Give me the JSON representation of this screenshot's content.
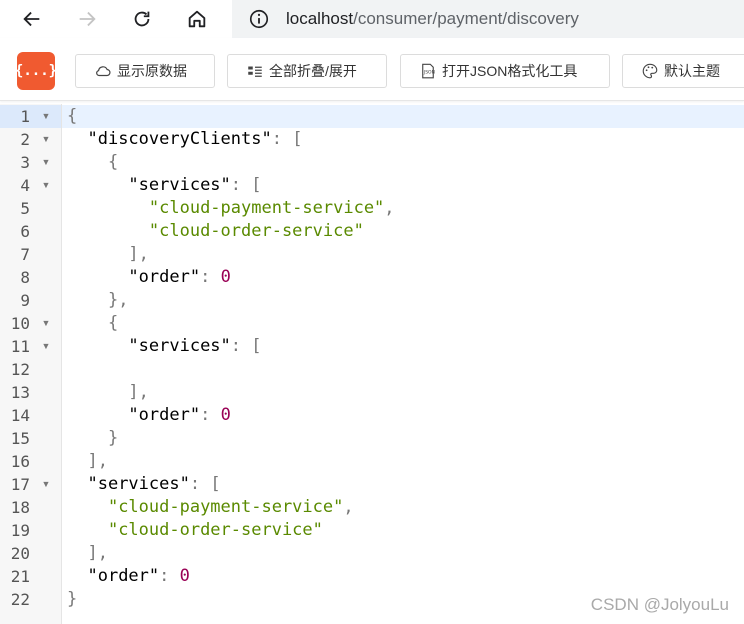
{
  "browser": {
    "url_host": "localhost",
    "url_path": "/consumer/payment/discovery",
    "icons": [
      "back-icon",
      "forward-icon",
      "reload-icon",
      "home-icon",
      "info-icon"
    ]
  },
  "toolbar": {
    "logo_text": "{...}",
    "raw_label": "显示原数据",
    "fold_label": "全部折叠/展开",
    "json_tool_label": "打开JSON格式化工具",
    "theme_label": "默认主题",
    "accent_color": "#f05a30"
  },
  "json_view": {
    "lines": [
      {
        "n": "1",
        "fold": true,
        "indent": 0,
        "tokens": [
          {
            "t": "p",
            "v": "{"
          }
        ]
      },
      {
        "n": "2",
        "fold": true,
        "indent": 1,
        "tokens": [
          {
            "t": "k",
            "v": "\"discoveryClients\""
          },
          {
            "t": "p",
            "v": ": ["
          }
        ]
      },
      {
        "n": "3",
        "fold": true,
        "indent": 2,
        "tokens": [
          {
            "t": "p",
            "v": "{"
          }
        ]
      },
      {
        "n": "4",
        "fold": true,
        "indent": 3,
        "tokens": [
          {
            "t": "k",
            "v": "\"services\""
          },
          {
            "t": "p",
            "v": ": ["
          }
        ]
      },
      {
        "n": "5",
        "fold": false,
        "indent": 4,
        "tokens": [
          {
            "t": "s",
            "v": "\"cloud-payment-service\""
          },
          {
            "t": "p",
            "v": ","
          }
        ]
      },
      {
        "n": "6",
        "fold": false,
        "indent": 4,
        "tokens": [
          {
            "t": "s",
            "v": "\"cloud-order-service\""
          }
        ]
      },
      {
        "n": "7",
        "fold": false,
        "indent": 3,
        "tokens": [
          {
            "t": "p",
            "v": "],"
          }
        ]
      },
      {
        "n": "8",
        "fold": false,
        "indent": 3,
        "tokens": [
          {
            "t": "k",
            "v": "\"order\""
          },
          {
            "t": "p",
            "v": ": "
          },
          {
            "t": "n",
            "v": "0"
          }
        ]
      },
      {
        "n": "9",
        "fold": false,
        "indent": 2,
        "tokens": [
          {
            "t": "p",
            "v": "},"
          }
        ]
      },
      {
        "n": "10",
        "fold": true,
        "indent": 2,
        "tokens": [
          {
            "t": "p",
            "v": "{"
          }
        ]
      },
      {
        "n": "11",
        "fold": true,
        "indent": 3,
        "tokens": [
          {
            "t": "k",
            "v": "\"services\""
          },
          {
            "t": "p",
            "v": ": ["
          }
        ]
      },
      {
        "n": "12",
        "fold": false,
        "indent": 3,
        "tokens": []
      },
      {
        "n": "13",
        "fold": false,
        "indent": 3,
        "tokens": [
          {
            "t": "p",
            "v": "],"
          }
        ]
      },
      {
        "n": "14",
        "fold": false,
        "indent": 3,
        "tokens": [
          {
            "t": "k",
            "v": "\"order\""
          },
          {
            "t": "p",
            "v": ": "
          },
          {
            "t": "n",
            "v": "0"
          }
        ]
      },
      {
        "n": "15",
        "fold": false,
        "indent": 2,
        "tokens": [
          {
            "t": "p",
            "v": "}"
          }
        ]
      },
      {
        "n": "16",
        "fold": false,
        "indent": 1,
        "tokens": [
          {
            "t": "p",
            "v": "],"
          }
        ]
      },
      {
        "n": "17",
        "fold": true,
        "indent": 1,
        "tokens": [
          {
            "t": "k",
            "v": "\"services\""
          },
          {
            "t": "p",
            "v": ": ["
          }
        ]
      },
      {
        "n": "18",
        "fold": false,
        "indent": 2,
        "tokens": [
          {
            "t": "s",
            "v": "\"cloud-payment-service\""
          },
          {
            "t": "p",
            "v": ","
          }
        ]
      },
      {
        "n": "19",
        "fold": false,
        "indent": 2,
        "tokens": [
          {
            "t": "s",
            "v": "\"cloud-order-service\""
          }
        ]
      },
      {
        "n": "20",
        "fold": false,
        "indent": 1,
        "tokens": [
          {
            "t": "p",
            "v": "],"
          }
        ]
      },
      {
        "n": "21",
        "fold": false,
        "indent": 1,
        "tokens": [
          {
            "t": "k",
            "v": "\"order\""
          },
          {
            "t": "p",
            "v": ": "
          },
          {
            "t": "n",
            "v": "0"
          }
        ]
      },
      {
        "n": "22",
        "fold": false,
        "indent": 0,
        "tokens": [
          {
            "t": "p",
            "v": "}"
          }
        ]
      }
    ],
    "colors": {
      "key": "#000000",
      "string": "#5a8a00",
      "number": "#990055",
      "punct": "#777777"
    }
  },
  "watermark": "CSDN @JolyouLu"
}
